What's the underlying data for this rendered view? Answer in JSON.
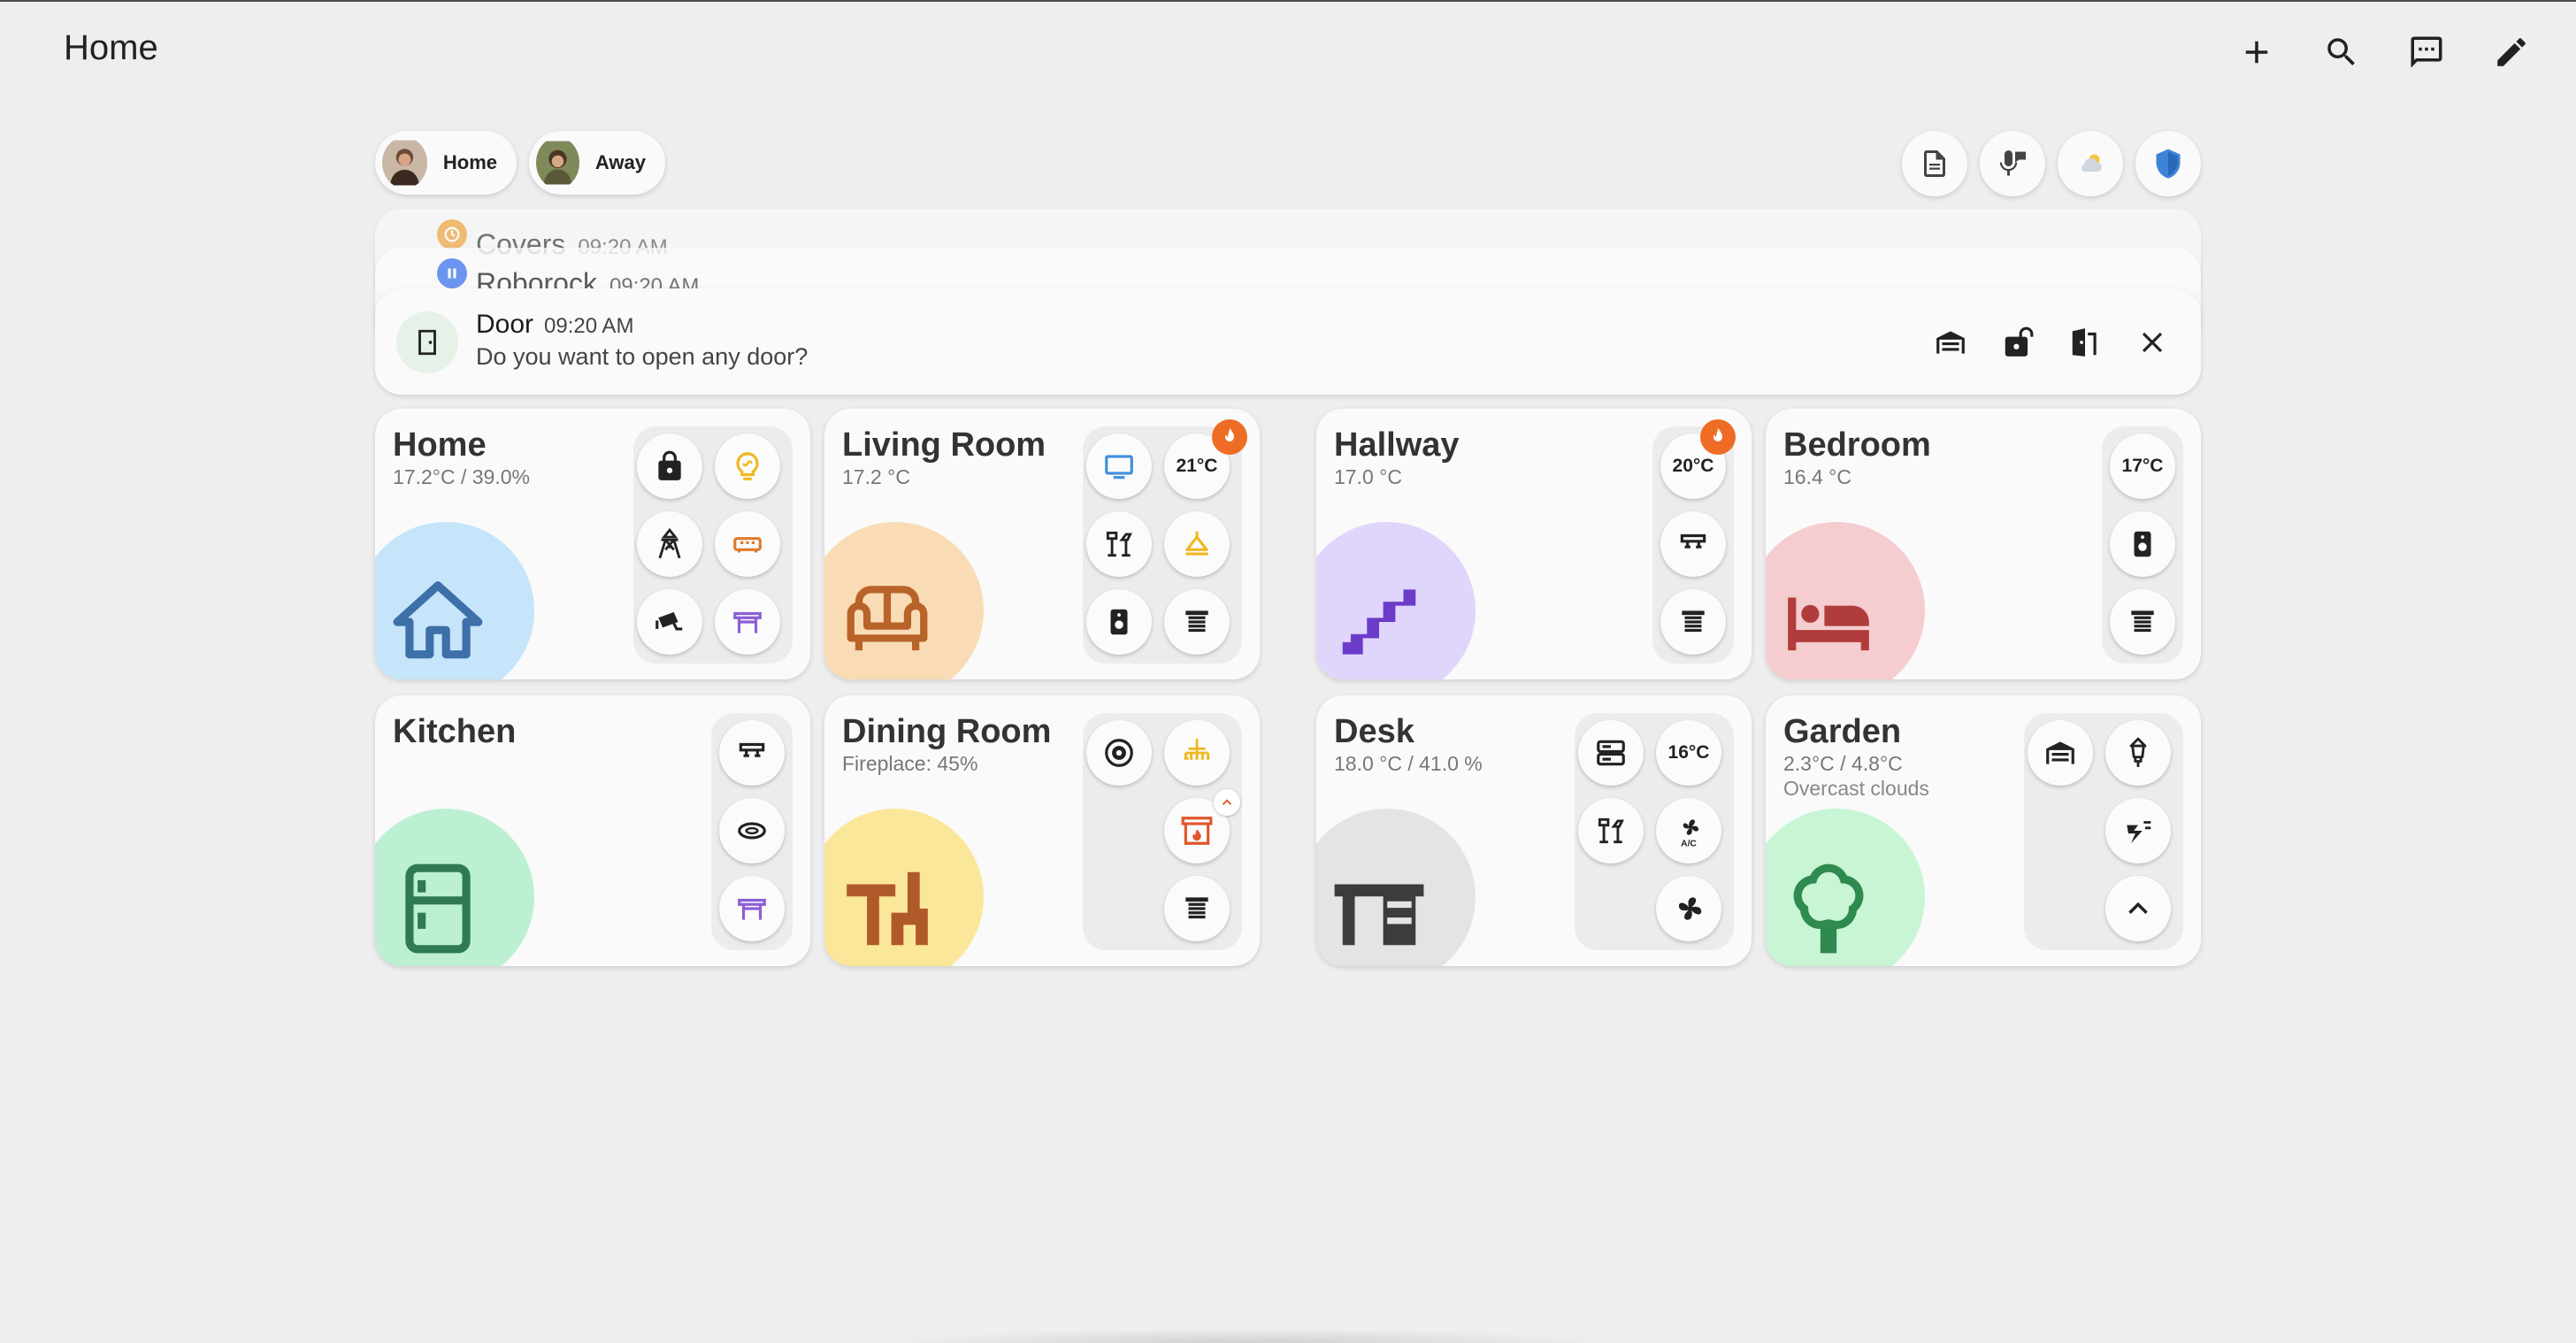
{
  "header": {
    "title": "Home",
    "actions": [
      "plus-icon",
      "search-icon",
      "chat-icon",
      "pencil-icon"
    ]
  },
  "persons": [
    {
      "label": "Home",
      "icon": "person-avatar"
    },
    {
      "label": "Away",
      "icon": "person-avatar"
    }
  ],
  "quick_actions": [
    "document-icon",
    "voice-icon",
    "weather-icon",
    "shield-icon"
  ],
  "notifications": {
    "stacked": [
      {
        "title": "Covers",
        "time": "09:20 AM",
        "icon": "clock-badge-icon",
        "color": "#f0a030"
      },
      {
        "title": "Roborock",
        "time": "09:20 AM",
        "icon": "pause-badge-icon",
        "color": "#4a7ef0"
      }
    ],
    "main": {
      "title": "Door",
      "time": "09:20 AM",
      "message": "Do you want to open any door?",
      "actions": [
        "garage-icon",
        "lock-open-icon",
        "door-open-icon",
        "close-icon"
      ]
    }
  },
  "rooms": [
    {
      "title": "Home",
      "subtitle": "17.2°C / 39.0%",
      "color": "#c6e4fa",
      "icon": "house-icon",
      "icon_color": "#3d6fa8",
      "entities": [
        "lock-icon",
        "light-bulb-icon",
        "power-tower-icon",
        "sofa-icon",
        "cctv-icon",
        "table-icon"
      ]
    },
    {
      "title": "Living Room",
      "subtitle": "17.2 °C",
      "color": "#f9dcb5",
      "icon": "sofa-icon",
      "icon_color": "#b8632a",
      "entities": [
        "tv-icon",
        "21°C",
        "desk-lamp-icon",
        "ceiling-light-icon",
        "speaker-icon",
        "blinds-icon"
      ]
    },
    {
      "title": "Hallway",
      "subtitle": "17.0 °C",
      "color": "#e0d5fb",
      "icon": "stairs-icon",
      "icon_color": "#6b3cc9",
      "entities": [
        "20°C",
        "ceiling-lamp-icon",
        "blinds-icon"
      ]
    },
    {
      "title": "Bedroom",
      "subtitle": "16.4 °C",
      "color": "#f5cdd0",
      "icon": "bed-icon",
      "icon_color": "#b03c3c",
      "entities": [
        "17°C",
        "speaker-icon",
        "blinds-icon"
      ]
    },
    {
      "title": "Kitchen",
      "subtitle": "",
      "color": "#bdf0d2",
      "icon": "fridge-icon",
      "icon_color": "#2f7a55",
      "entities": [
        "ceiling-lamp-icon",
        "robot-vacuum-icon",
        "table-icon"
      ]
    },
    {
      "title": "Dining Room",
      "subtitle": "Fireplace: 45%",
      "color": "#fbe79a",
      "icon": "dining-table-icon",
      "icon_color": "#b05a2a",
      "entities": [
        "robot-vacuum-icon",
        "chandelier-icon",
        "fireplace-icon",
        "blinds-icon"
      ]
    },
    {
      "title": "Desk",
      "subtitle": "18.0 °C / 41.0 %",
      "color": "#e4e4e4",
      "icon": "desk-icon",
      "icon_color": "#3c3c3c",
      "entities": [
        "server-icon",
        "16°C",
        "desk-lamp-icon",
        "ac-fan-icon",
        "fan-icon"
      ]
    },
    {
      "title": "Garden",
      "subtitle": "2.3°C / 4.8°C",
      "subtitle2": "Overcast clouds",
      "color": "#c8f5d3",
      "icon": "tree-icon",
      "icon_color": "#2e8a4e",
      "entities": [
        "garage-icon",
        "outdoor-lamp-icon",
        "lightning-icon",
        "chevron-up-icon"
      ]
    }
  ]
}
